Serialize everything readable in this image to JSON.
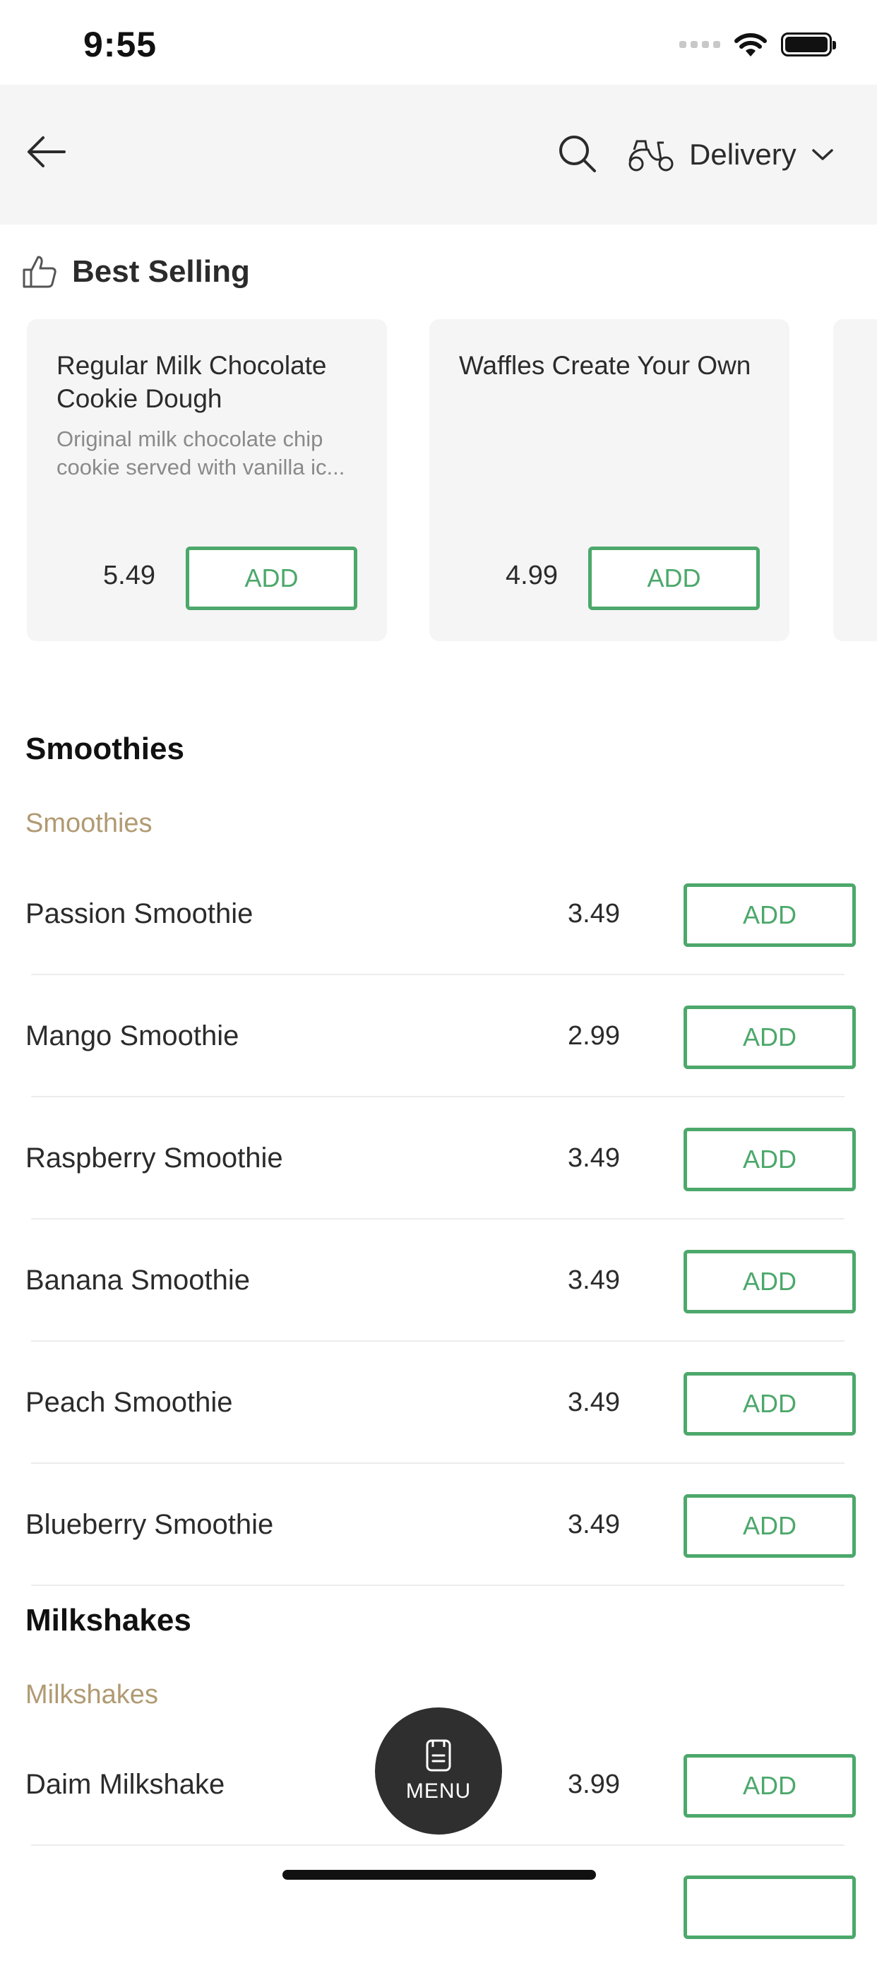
{
  "status_bar": {
    "time": "9:55"
  },
  "header": {
    "back_icon": "arrow-left-icon",
    "search_icon": "search-icon",
    "delivery_icon": "scooter-icon",
    "delivery_label": "Delivery",
    "dropdown_icon": "chevron-down-icon"
  },
  "best_selling": {
    "title": "Best Selling",
    "icon": "thumbs-up-icon",
    "cards": [
      {
        "name": "Regular Milk Chocolate Cookie Dough",
        "description": "Original milk chocolate chip cookie served with vanilla ic...",
        "price": "5.49",
        "add_label": "ADD"
      },
      {
        "name": "Waffles Create Your Own",
        "description": "",
        "price": "4.99",
        "add_label": "ADD"
      }
    ]
  },
  "sections": [
    {
      "title": "Smoothies",
      "subtitle": "Smoothies",
      "items": [
        {
          "name": "Passion Smoothie",
          "price": "3.49",
          "add_label": "ADD"
        },
        {
          "name": "Mango Smoothie",
          "price": "2.99",
          "add_label": "ADD"
        },
        {
          "name": "Raspberry Smoothie",
          "price": "3.49",
          "add_label": "ADD"
        },
        {
          "name": "Banana Smoothie",
          "price": "3.49",
          "add_label": "ADD"
        },
        {
          "name": "Peach Smoothie",
          "price": "3.49",
          "add_label": "ADD"
        },
        {
          "name": "Blueberry Smoothie",
          "price": "3.49",
          "add_label": "ADD"
        }
      ]
    },
    {
      "title": "Milkshakes",
      "subtitle": "Milkshakes",
      "items": [
        {
          "name": "Daim Milkshake",
          "price": "3.99",
          "add_label": "ADD"
        }
      ]
    }
  ],
  "menu_button": {
    "label": "MENU",
    "icon": "menu-book-icon"
  },
  "colors": {
    "accent_green": "#4ca86b",
    "subsection_gold": "#b09a72",
    "header_bg": "#f5f5f5",
    "fab_bg": "#2f2f2f"
  }
}
